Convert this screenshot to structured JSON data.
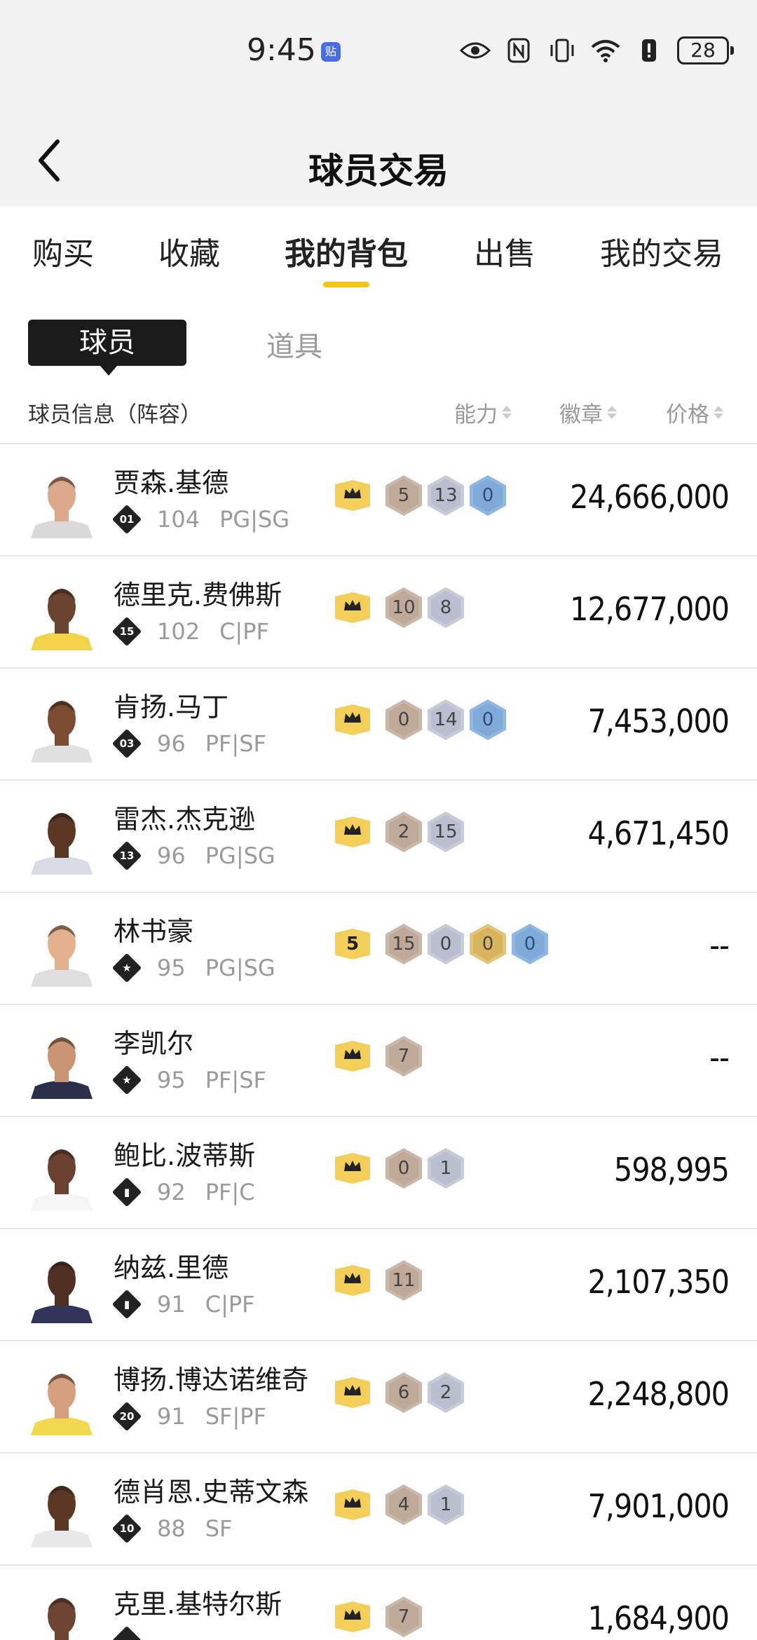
{
  "status": {
    "time": "9:45",
    "app_badge": "贴",
    "battery": "28"
  },
  "nav": {
    "title": "球员交易"
  },
  "tabs": [
    {
      "label": "购买"
    },
    {
      "label": "收藏"
    },
    {
      "label": "我的背包",
      "active": true
    },
    {
      "label": "出售"
    },
    {
      "label": "我的交易"
    }
  ],
  "subtabs": {
    "active": "球员",
    "other": "道具"
  },
  "columns": {
    "info": "球员信息（阵容）",
    "ability": "能力",
    "badge": "徽章",
    "price": "价格"
  },
  "colors": {
    "accent": "#f5c518",
    "bronze": "#c9b8aa",
    "silver": "#c7cbd8",
    "gold": "#e3c47b",
    "blue": "#8fb7e2"
  },
  "players": [
    {
      "name": "贾森.基德",
      "rank": "01",
      "rating": "104",
      "pos": "PG|SG",
      "tier": "crown",
      "badges": [
        {
          "t": "bronze",
          "v": "5"
        },
        {
          "t": "silver",
          "v": "13"
        },
        {
          "t": "blue",
          "v": "0"
        }
      ],
      "price": "24,666,000",
      "skin": "#d9a98a",
      "jersey": "#d9d9d9"
    },
    {
      "name": "德里克.费佛斯",
      "rank": "15",
      "rating": "102",
      "pos": "C|PF",
      "tier": "crown",
      "badges": [
        {
          "t": "bronze",
          "v": "10"
        },
        {
          "t": "silver",
          "v": "8"
        }
      ],
      "price": "12,677,000",
      "skin": "#6b4431",
      "jersey": "#f2d34a"
    },
    {
      "name": "肯扬.马丁",
      "rank": "03",
      "rating": "96",
      "pos": "PF|SF",
      "tier": "crown",
      "badges": [
        {
          "t": "bronze",
          "v": "0"
        },
        {
          "t": "silver",
          "v": "14"
        },
        {
          "t": "blue",
          "v": "0"
        }
      ],
      "price": "7,453,000",
      "skin": "#7b4c34",
      "jersey": "#e0e0e0"
    },
    {
      "name": "雷杰.杰克逊",
      "rank": "13",
      "rating": "96",
      "pos": "PG|SG",
      "tier": "crown",
      "badges": [
        {
          "t": "bronze",
          "v": "2"
        },
        {
          "t": "silver",
          "v": "15"
        }
      ],
      "price": "4,671,450",
      "skin": "#5a3624",
      "jersey": "#d8dbe6"
    },
    {
      "name": "林书豪",
      "rank": "★",
      "rating": "95",
      "pos": "PG|SG",
      "tier": "5",
      "badges": [
        {
          "t": "bronze",
          "v": "15"
        },
        {
          "t": "silver",
          "v": "0"
        },
        {
          "t": "gold",
          "v": "0"
        },
        {
          "t": "blue",
          "v": "0"
        }
      ],
      "price": "--",
      "skin": "#e2b18f",
      "jersey": "#dedede"
    },
    {
      "name": "李凯尔",
      "rank": "★",
      "rating": "95",
      "pos": "PF|SF",
      "tier": "crown",
      "badges": [
        {
          "t": "bronze",
          "v": "7"
        }
      ],
      "price": "--",
      "skin": "#c89472",
      "jersey": "#2a2f4a"
    },
    {
      "name": "鲍比.波蒂斯",
      "rank": "▮",
      "rating": "92",
      "pos": "PF|C",
      "tier": "crown",
      "badges": [
        {
          "t": "bronze",
          "v": "0"
        },
        {
          "t": "silver",
          "v": "1"
        }
      ],
      "price": "598,995",
      "skin": "#6a4130",
      "jersey": "#f5f5f5"
    },
    {
      "name": "纳兹.里德",
      "rank": "▮",
      "rating": "91",
      "pos": "C|PF",
      "tier": "crown",
      "badges": [
        {
          "t": "bronze",
          "v": "11"
        }
      ],
      "price": "2,107,350",
      "skin": "#4f3022",
      "jersey": "#2e3559"
    },
    {
      "name": "博扬.博达诺维奇",
      "rank": "20",
      "rating": "91",
      "pos": "SF|PF",
      "tier": "crown",
      "badges": [
        {
          "t": "bronze",
          "v": "6"
        },
        {
          "t": "silver",
          "v": "2"
        }
      ],
      "price": "2,248,800",
      "skin": "#d6a07f",
      "jersey": "#f2d84e"
    },
    {
      "name": "德肖恩.史蒂文森",
      "rank": "10",
      "rating": "88",
      "pos": "SF",
      "tier": "crown",
      "badges": [
        {
          "t": "bronze",
          "v": "4"
        },
        {
          "t": "silver",
          "v": "1"
        }
      ],
      "price": "7,901,000",
      "skin": "#5b3826",
      "jersey": "#e8e8e8"
    },
    {
      "name": "克里.基特尔斯",
      "rank": "",
      "rating": "",
      "pos": "",
      "tier": "crown",
      "badges": [
        {
          "t": "bronze",
          "v": "7"
        }
      ],
      "price": "1,684,900",
      "skin": "#6e4532",
      "jersey": "#e0e0e0"
    }
  ]
}
